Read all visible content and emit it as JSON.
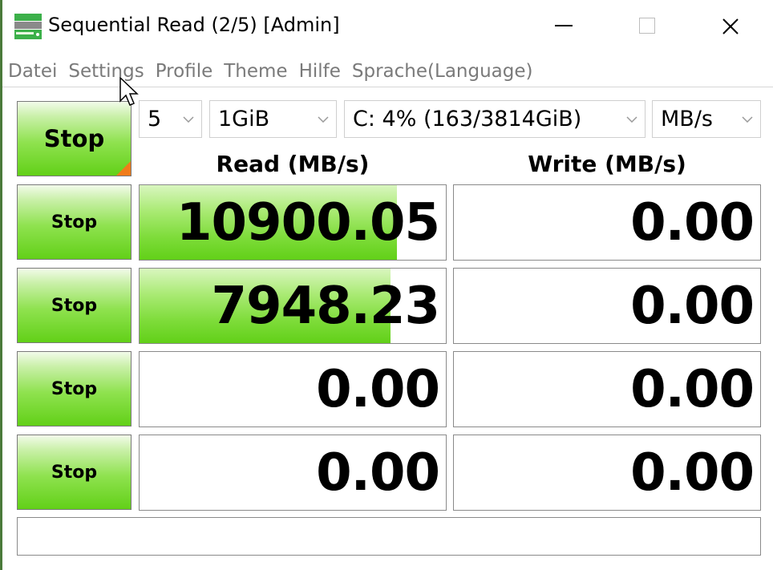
{
  "window": {
    "title": "Sequential Read (2/5) [Admin]",
    "icon": "crystaldiskmark-drive-icon",
    "controls": [
      "minimize",
      "maximize",
      "close"
    ]
  },
  "menu": [
    "Datei",
    "Settings",
    "Profile",
    "Theme",
    "Hilfe",
    "Sprache(Language)"
  ],
  "controls": {
    "all_button_label": "Stop",
    "count": "5",
    "size": "1GiB",
    "drive": "C: 4% (163/3814GiB)",
    "unit": "MB/s"
  },
  "headers": {
    "read": "Read (MB/s)",
    "write": "Write (MB/s)"
  },
  "rows": [
    {
      "button": "Stop",
      "read": "10900.05",
      "write": "0.00",
      "read_fill": 0.84
    },
    {
      "button": "Stop",
      "read": "7948.23",
      "write": "0.00",
      "read_fill": 0.82
    },
    {
      "button": "Stop",
      "read": "0.00",
      "write": "0.00",
      "read_fill": 0
    },
    {
      "button": "Stop",
      "read": "0.00",
      "write": "0.00",
      "read_fill": 0
    }
  ],
  "comment": "",
  "colors": {
    "button_green": "#62d018",
    "accent_orange": "#f07c1a",
    "border": "#8a8a8a"
  }
}
